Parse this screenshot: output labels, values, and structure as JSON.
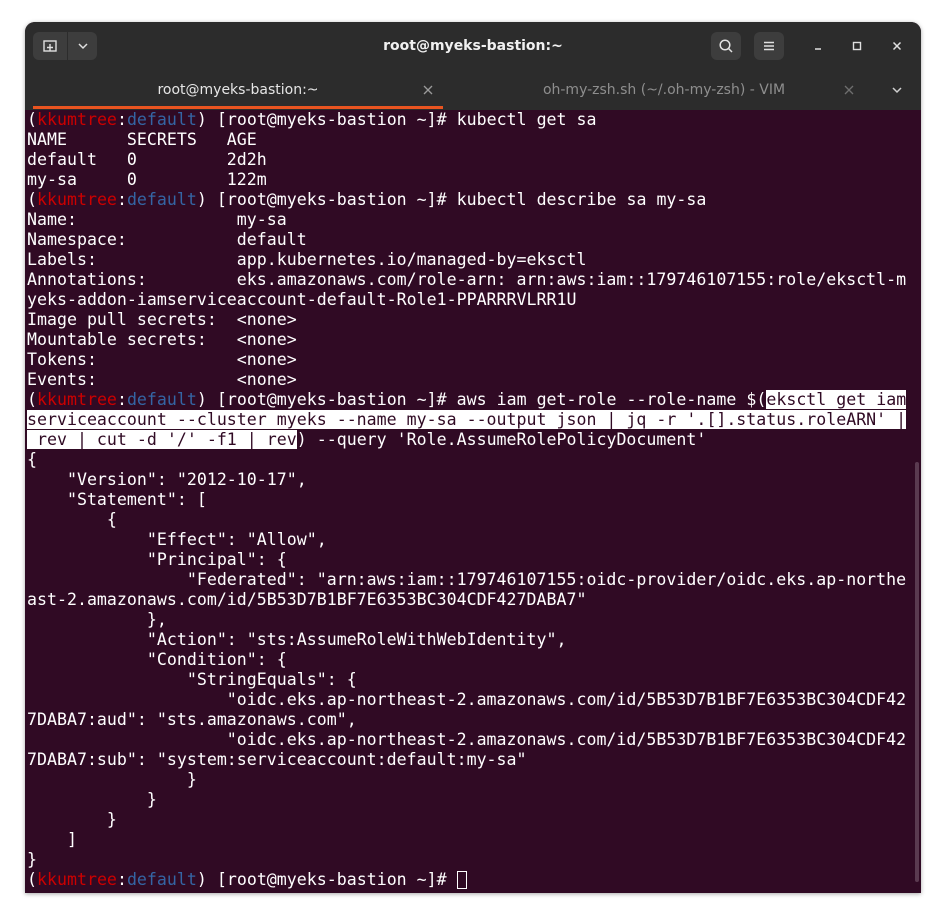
{
  "window": {
    "title": "root@myeks-bastion:~"
  },
  "tabs": [
    {
      "label": "root@myeks-bastion:~",
      "active": true
    },
    {
      "label": "oh-my-zsh.sh (~/.oh-my-zsh) - VIM",
      "active": false
    }
  ],
  "icons": {
    "new_tab": "new-tab-icon",
    "menu_dropdown": "chevron-down-icon",
    "search": "search-icon",
    "hamburger": "hamburger-menu-icon",
    "minimize": "minimize-icon",
    "maximize": "maximize-icon",
    "close": "close-icon",
    "tab_close": "close-icon",
    "tab_list": "chevron-down-icon"
  },
  "colors": {
    "terminal_bg": "#300a24",
    "prompt_user": "#cc0000",
    "prompt_ns": "#3465a4",
    "tab_indicator": "#e95420"
  },
  "prompt": {
    "user": "kkumtree",
    "namespace": "default",
    "host": "[root@myeks-bastion ~]# "
  },
  "terminal": {
    "lines": [
      {
        "type": "prompt",
        "cmd": "kubectl get sa"
      },
      {
        "type": "text",
        "text": "NAME      SECRETS   AGE"
      },
      {
        "type": "text",
        "text": "default   0         2d2h"
      },
      {
        "type": "text",
        "text": "my-sa     0         122m"
      },
      {
        "type": "prompt",
        "cmd": "kubectl describe sa my-sa"
      },
      {
        "type": "text",
        "text": "Name:                my-sa"
      },
      {
        "type": "text",
        "text": "Namespace:           default"
      },
      {
        "type": "text",
        "text": "Labels:              app.kubernetes.io/managed-by=eksctl"
      },
      {
        "type": "text",
        "text": "Annotations:         eks.amazonaws.com/role-arn: arn:aws:iam::179746107155:role/eksctl-m"
      },
      {
        "type": "text",
        "text": "yeks-addon-iamserviceaccount-default-Role1-PPARRRVLRR1U"
      },
      {
        "type": "text",
        "text": "Image pull secrets:  <none>"
      },
      {
        "type": "text",
        "text": "Mountable secrets:   <none>"
      },
      {
        "type": "text",
        "text": "Tokens:              <none>"
      },
      {
        "type": "text",
        "text": "Events:              <none>"
      },
      {
        "type": "prompt_sel",
        "cmd": "aws iam get-role --role-name $(",
        "sel": "eksctl get iam"
      },
      {
        "type": "sel",
        "text": "serviceaccount --cluster myeks --name my-sa --output json | jq -r '.[].status.roleARN' |"
      },
      {
        "type": "sel_tail",
        "sel": " rev | cut -d '/' -f1 | rev",
        "text": ") --query 'Role.AssumeRolePolicyDocument'"
      },
      {
        "type": "text",
        "text": "{"
      },
      {
        "type": "text",
        "text": "    \"Version\": \"2012-10-17\","
      },
      {
        "type": "text",
        "text": "    \"Statement\": ["
      },
      {
        "type": "text",
        "text": "        {"
      },
      {
        "type": "text",
        "text": "            \"Effect\": \"Allow\","
      },
      {
        "type": "text",
        "text": "            \"Principal\": {"
      },
      {
        "type": "text",
        "text": "                \"Federated\": \"arn:aws:iam::179746107155:oidc-provider/oidc.eks.ap-northe"
      },
      {
        "type": "text",
        "text": "ast-2.amazonaws.com/id/5B53D7B1BF7E6353BC304CDF427DABA7\""
      },
      {
        "type": "text",
        "text": "            },"
      },
      {
        "type": "text",
        "text": "            \"Action\": \"sts:AssumeRoleWithWebIdentity\","
      },
      {
        "type": "text",
        "text": "            \"Condition\": {"
      },
      {
        "type": "text",
        "text": "                \"StringEquals\": {"
      },
      {
        "type": "text",
        "text": "                    \"oidc.eks.ap-northeast-2.amazonaws.com/id/5B53D7B1BF7E6353BC304CDF42"
      },
      {
        "type": "text",
        "text": "7DABA7:aud\": \"sts.amazonaws.com\","
      },
      {
        "type": "text",
        "text": "                    \"oidc.eks.ap-northeast-2.amazonaws.com/id/5B53D7B1BF7E6353BC304CDF42"
      },
      {
        "type": "text",
        "text": "7DABA7:sub\": \"system:serviceaccount:default:my-sa\""
      },
      {
        "type": "text",
        "text": "                }"
      },
      {
        "type": "text",
        "text": "            }"
      },
      {
        "type": "text",
        "text": "        }"
      },
      {
        "type": "text",
        "text": "    ]"
      },
      {
        "type": "text",
        "text": "}"
      },
      {
        "type": "prompt_cursor",
        "cmd": ""
      }
    ]
  }
}
